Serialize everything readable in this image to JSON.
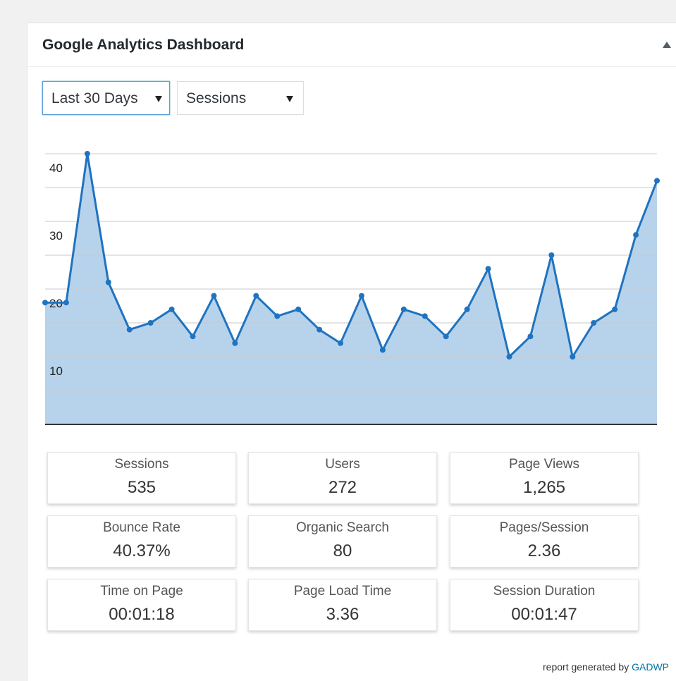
{
  "widget": {
    "title": "Google Analytics Dashboard"
  },
  "controls": {
    "range_selected": "Last 30 Days",
    "metric_selected": "Sessions"
  },
  "chart_data": {
    "type": "area",
    "title": "",
    "xlabel": "",
    "ylabel": "",
    "yticks": [
      10,
      20,
      30,
      40
    ],
    "ylim": [
      0,
      40
    ],
    "series": [
      {
        "values": [
          18,
          18,
          40,
          21,
          14,
          15,
          17,
          13,
          19,
          12,
          19,
          16,
          17,
          14,
          12,
          19,
          11,
          17,
          16,
          13,
          17,
          23,
          10,
          13,
          25,
          10,
          15,
          17,
          28,
          36
        ]
      }
    ],
    "grid": true,
    "colors": {
      "line": "#1f73c0",
      "fill": "#b7d3ec",
      "grid": "#c8c8c8"
    }
  },
  "stats": [
    {
      "label": "Sessions",
      "value": "535"
    },
    {
      "label": "Users",
      "value": "272"
    },
    {
      "label": "Page Views",
      "value": "1,265"
    },
    {
      "label": "Bounce Rate",
      "value": "40.37%"
    },
    {
      "label": "Organic Search",
      "value": "80"
    },
    {
      "label": "Pages/Session",
      "value": "2.36"
    },
    {
      "label": "Time on Page",
      "value": "00:01:18"
    },
    {
      "label": "Page Load Time",
      "value": "3.36"
    },
    {
      "label": "Session Duration",
      "value": "00:01:47"
    }
  ],
  "footer": {
    "prefix": "report generated by",
    "link": "GADWP"
  }
}
